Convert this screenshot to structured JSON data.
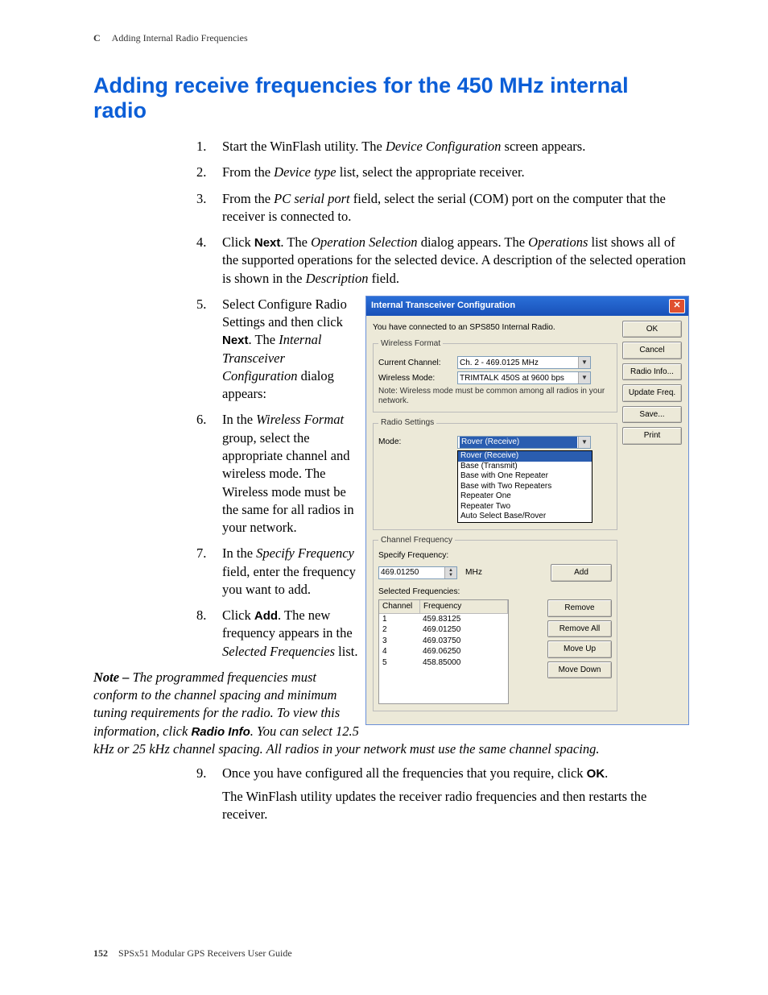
{
  "header": {
    "appendix": "C",
    "section": "Adding Internal Radio Frequencies"
  },
  "title": "Adding receive frequencies for the 450 MHz internal radio",
  "steps": {
    "s1_a": "Start the WinFlash utility. The ",
    "s1_b": "Device Configuration",
    "s1_c": " screen appears.",
    "s2_a": "From the ",
    "s2_b": "Device type",
    "s2_c": " list, select the appropriate receiver.",
    "s3_a": "From the ",
    "s3_b": "PC serial port",
    "s3_c": " field, select the serial (COM) port on the computer that the receiver is connected to.",
    "s4_a": "Click ",
    "s4_b": "Next",
    "s4_c": ". The ",
    "s4_d": "Operation Selection",
    "s4_e": " dialog appears. The ",
    "s4_f": "Operations",
    "s4_g": " list shows all of the supported operations for the selected device. A description of the selected operation is shown in the ",
    "s4_h": "Description",
    "s4_i": " field.",
    "s5_a": "Select Configure Radio Settings and then click ",
    "s5_b": "Next",
    "s5_c": ". The ",
    "s5_d": "Internal Transceiver Configuration",
    "s5_e": " dialog appears:",
    "s6_a": "In the ",
    "s6_b": "Wireless Format",
    "s6_c": " group, select the appropriate channel and wireless mode. The Wireless mode must be the same for all radios in your network.",
    "s7_a": "In the ",
    "s7_b": "Specify Frequency",
    "s7_c": " field, enter the frequency you want to add.",
    "s8_a": "Click ",
    "s8_b": "Add",
    "s8_c": ". The new frequency appears in the ",
    "s8_d": "Selected Frequencies",
    "s8_e": " list.",
    "s9_a": "Once you have configured all the frequencies that you require, click ",
    "s9_b": "OK",
    "s9_c": ".",
    "s9_d": "The WinFlash utility updates the receiver radio frequencies and then restarts the receiver."
  },
  "note": {
    "label": "Note – ",
    "body_a": "The programmed frequencies must conform to the channel spacing and minimum tuning requirements for the radio. To view this information, click ",
    "body_b": "Radio Info",
    "body_c": ". You can select 12.5 kHz or 25 kHz channel spacing. All radios in your network must use the same channel spacing."
  },
  "dialog": {
    "title": "Internal Transceiver Configuration",
    "intro": "You have connected to an SPS850 Internal Radio.",
    "buttons": {
      "ok": "OK",
      "cancel": "Cancel",
      "radio_info": "Radio Info...",
      "update_freq": "Update Freq.",
      "save": "Save...",
      "print": "Print"
    },
    "wireless": {
      "legend": "Wireless Format",
      "current_channel_lbl": "Current Channel:",
      "current_channel_val": "Ch.  2 - 469.0125 MHz",
      "wireless_mode_lbl": "Wireless Mode:",
      "wireless_mode_val": "TRIMTALK 450S at 9600 bps",
      "hint": "Note: Wireless mode must be common among all radios in your network."
    },
    "radio_settings": {
      "legend": "Radio Settings",
      "mode_lbl": "Mode:",
      "mode_val": "Rover (Receive)",
      "options": [
        "Rover (Receive)",
        "Base (Transmit)",
        "Base with One Repeater",
        "Base with Two Repeaters",
        "Repeater One",
        "Repeater Two",
        "Auto Select Base/Rover"
      ]
    },
    "channel_freq": {
      "legend": "Channel Frequency",
      "specify_lbl": "Specify Frequency:",
      "specify_val": "469.01250",
      "unit": "MHz",
      "add": "Add",
      "selected_lbl": "Selected Frequencies:",
      "col_channel": "Channel",
      "col_freq": "Frequency",
      "rows": [
        {
          "ch": "1",
          "fr": "459.83125"
        },
        {
          "ch": "2",
          "fr": "469.01250"
        },
        {
          "ch": "3",
          "fr": "469.03750"
        },
        {
          "ch": "4",
          "fr": "469.06250"
        },
        {
          "ch": "5",
          "fr": "458.85000"
        }
      ],
      "remove": "Remove",
      "remove_all": "Remove All",
      "move_up": "Move Up",
      "move_down": "Move Down"
    }
  },
  "footer": {
    "page": "152",
    "book": "SPSx51 Modular GPS Receivers User Guide"
  }
}
